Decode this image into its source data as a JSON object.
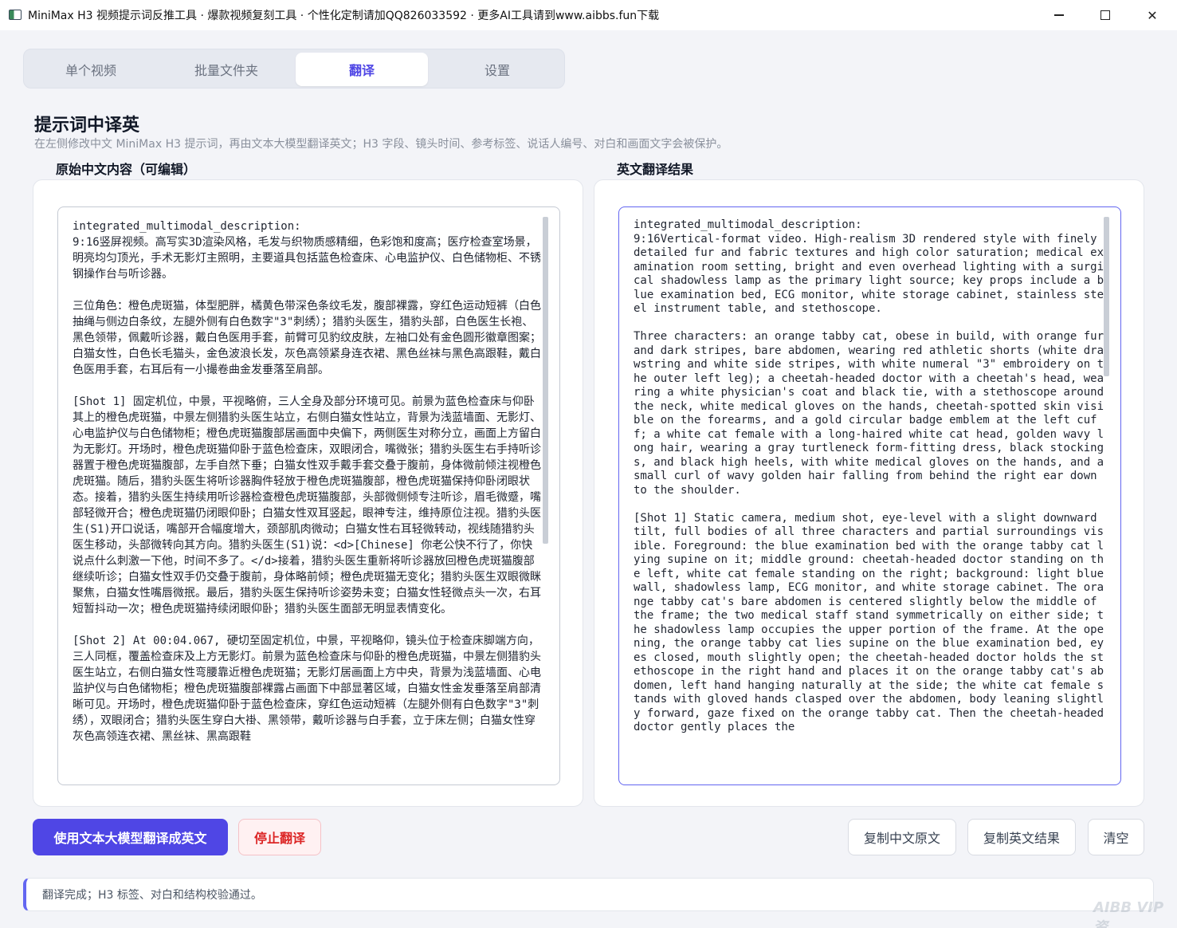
{
  "window": {
    "title": "MiniMax H3 视频提示词反推工具 · 爆款视频复刻工具 · 个性化定制请加QQ826033592 · 更多AI工具请到www.aibbs.fun下载"
  },
  "tabs": [
    {
      "label": "单个视频",
      "active": false
    },
    {
      "label": "批量文件夹",
      "active": false
    },
    {
      "label": "翻译",
      "active": true
    },
    {
      "label": "设置",
      "active": false
    }
  ],
  "page": {
    "title": "提示词中译英",
    "subtitle": "在左侧修改中文 MiniMax H3 提示词，再由文本大模型翻译英文；H3 字段、镜头时间、参考标签、说话人编号、对白和画面文字会被保护。"
  },
  "left_panel": {
    "label": "原始中文内容（可编辑）",
    "text": "integrated_multimodal_description:\n9:16竖屏视频。高写实3D渲染风格，毛发与织物质感精细，色彩饱和度高；医疗检查室场景，明亮均匀顶光，手术无影灯主照明，主要道具包括蓝色检查床、心电监护仪、白色储物柜、不锈钢操作台与听诊器。\n\n三位角色：橙色虎斑猫，体型肥胖，橘黄色带深色条纹毛发，腹部裸露，穿红色运动短裤（白色抽绳与侧边白条纹，左腿外侧有白色数字\"3\"刺绣）；猎豹头医生，猎豹头部，白色医生长袍、黑色领带，佩戴听诊器，戴白色医用手套，前臂可见豹纹皮肤，左袖口处有金色圆形徽章图案；白猫女性，白色长毛猫头，金色波浪长发，灰色高领紧身连衣裙、黑色丝袜与黑色高跟鞋，戴白色医用手套，右耳后有一小撮卷曲金发垂落至肩部。\n\n[Shot 1] 固定机位，中景，平视略俯，三人全身及部分环境可见。前景为蓝色检查床与仰卧其上的橙色虎斑猫，中景左侧猎豹头医生站立，右侧白猫女性站立，背景为浅蓝墙面、无影灯、心电监护仪与白色储物柜；橙色虎斑猫腹部居画面中央偏下，两侧医生对称分立，画面上方留白为无影灯。开场时，橙色虎斑猫仰卧于蓝色检查床，双眼闭合，嘴微张；猎豹头医生右手持听诊器置于橙色虎斑猫腹部，左手自然下垂；白猫女性双手戴手套交叠于腹前，身体微前倾注视橙色虎斑猫。随后，猎豹头医生将听诊器胸件轻放于橙色虎斑猫腹部，橙色虎斑猫保持仰卧闭眼状态。接着，猎豹头医生持续用听诊器检查橙色虎斑猫腹部，头部微侧倾专注听诊，眉毛微蹙，嘴部轻微开合；橙色虎斑猫仍闭眼仰卧；白猫女性双耳竖起，眼神专注，维持原位注视。猎豹头医生(S1)开口说话，嘴部开合幅度增大，颈部肌肉微动；白猫女性右耳轻微转动，视线随猎豹头医生移动，头部微转向其方向。猎豹头医生(S1)说：<d>[Chinese] 你老公快不行了，你快说点什么刺激一下他，时间不多了。</d>接着，猎豹头医生重新将听诊器放回橙色虎斑猫腹部继续听诊；白猫女性双手仍交叠于腹前，身体略前倾；橙色虎斑猫无变化；猎豹头医生双眼微眯聚焦，白猫女性嘴唇微抿。最后，猎豹头医生保持听诊姿势未变；白猫女性轻微点头一次，右耳短暂抖动一次；橙色虎斑猫持续闭眼仰卧；猎豹头医生面部无明显表情变化。\n\n[Shot 2] At 00:04.067, 硬切至固定机位，中景，平视略仰，镜头位于检查床脚端方向，三人同框，覆盖检查床及上方无影灯。前景为蓝色检查床与仰卧的橙色虎斑猫，中景左侧猎豹头医生站立，右侧白猫女性弯腰靠近橙色虎斑猫；无影灯居画面上方中央，背景为浅蓝墙面、心电监护仪与白色储物柜；橙色虎斑猫腹部裸露占画面下中部显著区域，白猫女性金发垂落至肩部清晰可见。开场时，橙色虎斑猫仰卧于蓝色检查床，穿红色运动短裤（左腿外侧有白色数字\"3\"刺绣），双眼闭合；猎豹头医生穿白大褂、黑领带，戴听诊器与白手套，立于床左侧；白猫女性穿灰色高领连衣裙、黑丝袜、黑高跟鞋"
  },
  "right_panel": {
    "label": "英文翻译结果",
    "text": "integrated_multimodal_description:\n9:16Vertical-format video. High-realism 3D rendered style with finely detailed fur and fabric textures and high color saturation; medical examination room setting, bright and even overhead lighting with a surgical shadowless lamp as the primary light source; key props include a blue examination bed, ECG monitor, white storage cabinet, stainless steel instrument table, and stethoscope.\n\nThree characters: an orange tabby cat, obese in build, with orange fur and dark stripes, bare abdomen, wearing red athletic shorts (white drawstring and white side stripes, with white numeral \"3\" embroidery on the outer left leg); a cheetah-headed doctor with a cheetah's head, wearing a white physician's coat and black tie, with a stethoscope around the neck, white medical gloves on the hands, cheetah-spotted skin visible on the forearms, and a gold circular badge emblem at the left cuff; a white cat female with a long-haired white cat head, golden wavy long hair, wearing a gray turtleneck form-fitting dress, black stockings, and black high heels, with white medical gloves on the hands, and a small curl of wavy golden hair falling from behind the right ear down to the shoulder.\n\n[Shot 1] Static camera, medium shot, eye-level with a slight downward tilt, full bodies of all three characters and partial surroundings visible. Foreground: the blue examination bed with the orange tabby cat lying supine on it; middle ground: cheetah-headed doctor standing on the left, white cat female standing on the right; background: light blue wall, shadowless lamp, ECG monitor, and white storage cabinet. The orange tabby cat's bare abdomen is centered slightly below the middle of the frame; the two medical staff stand symmetrically on either side; the shadowless lamp occupies the upper portion of the frame. At the opening, the orange tabby cat lies supine on the blue examination bed, eyes closed, mouth slightly open; the cheetah-headed doctor holds the stethoscope in the right hand and places it on the orange tabby cat's abdomen, left hand hanging naturally at the side; the white cat female stands with gloved hands clasped over the abdomen, body leaning slightly forward, gaze fixed on the orange tabby cat. Then the cheetah-headed doctor gently places the"
  },
  "buttons": {
    "translate": "使用文本大模型翻译成英文",
    "stop": "停止翻译",
    "copy_cn": "复制中文原文",
    "copy_en": "复制英文结果",
    "clear": "清空"
  },
  "status": {
    "message": "翻译完成；H3 标签、对白和结构校验通过。"
  },
  "watermark": "AIBB VIP资"
}
